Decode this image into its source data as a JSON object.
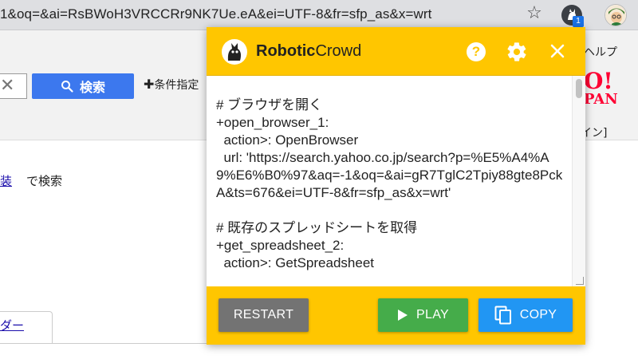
{
  "browser": {
    "url": "1&oq=&ai=RsBWoH3VRCCRr9NK7Ue.eA&ei=UTF-8&fr=sfp_as&x=wrt",
    "extension_badge": "1"
  },
  "background_page": {
    "search_button_label": "検索",
    "condition_link": "条件指定",
    "help_link": "ヘルプ",
    "logo_line1": "O!",
    "logo_line2": "PAN",
    "signin_link": "イン]",
    "hint_link": "装",
    "hint_text": "で検索",
    "tab_link": "ダー"
  },
  "popup": {
    "brand_bold": "Robotic",
    "brand_regular": "Crowd",
    "help_icon_glyph": "?",
    "code": "# ブラウザを開く\n+open_browser_1:\n  action>: OpenBrowser\n  url: 'https://search.yahoo.co.jp/search?p=%E5%A4%A9%E6%B0%97&aq=-1&oq=&ai=gR7TglC2Tpiy88gte8PckA&ts=676&ei=UTF-8&fr=sfp_as&x=wrt'\n\n# 既存のスプレッドシートを取得\n+get_spreadsheet_2:\n  action>: GetSpreadsheet",
    "restart_label": "RESTART",
    "play_label": "PLAY",
    "copy_label": "COPY"
  },
  "colors": {
    "popup_accent": "#ffc600",
    "restart": "#737373",
    "play": "#45ac4a",
    "copy": "#2196f3",
    "search_button": "#3c78ee",
    "yahoo_red": "#ff0033"
  },
  "icons": [
    "star-icon",
    "extension-icon",
    "avatar",
    "clear-icon",
    "search-icon",
    "plus-icon",
    "robot-cat-logo-icon",
    "help-icon",
    "gear-icon",
    "close-icon",
    "play-icon",
    "copy-icon"
  ]
}
